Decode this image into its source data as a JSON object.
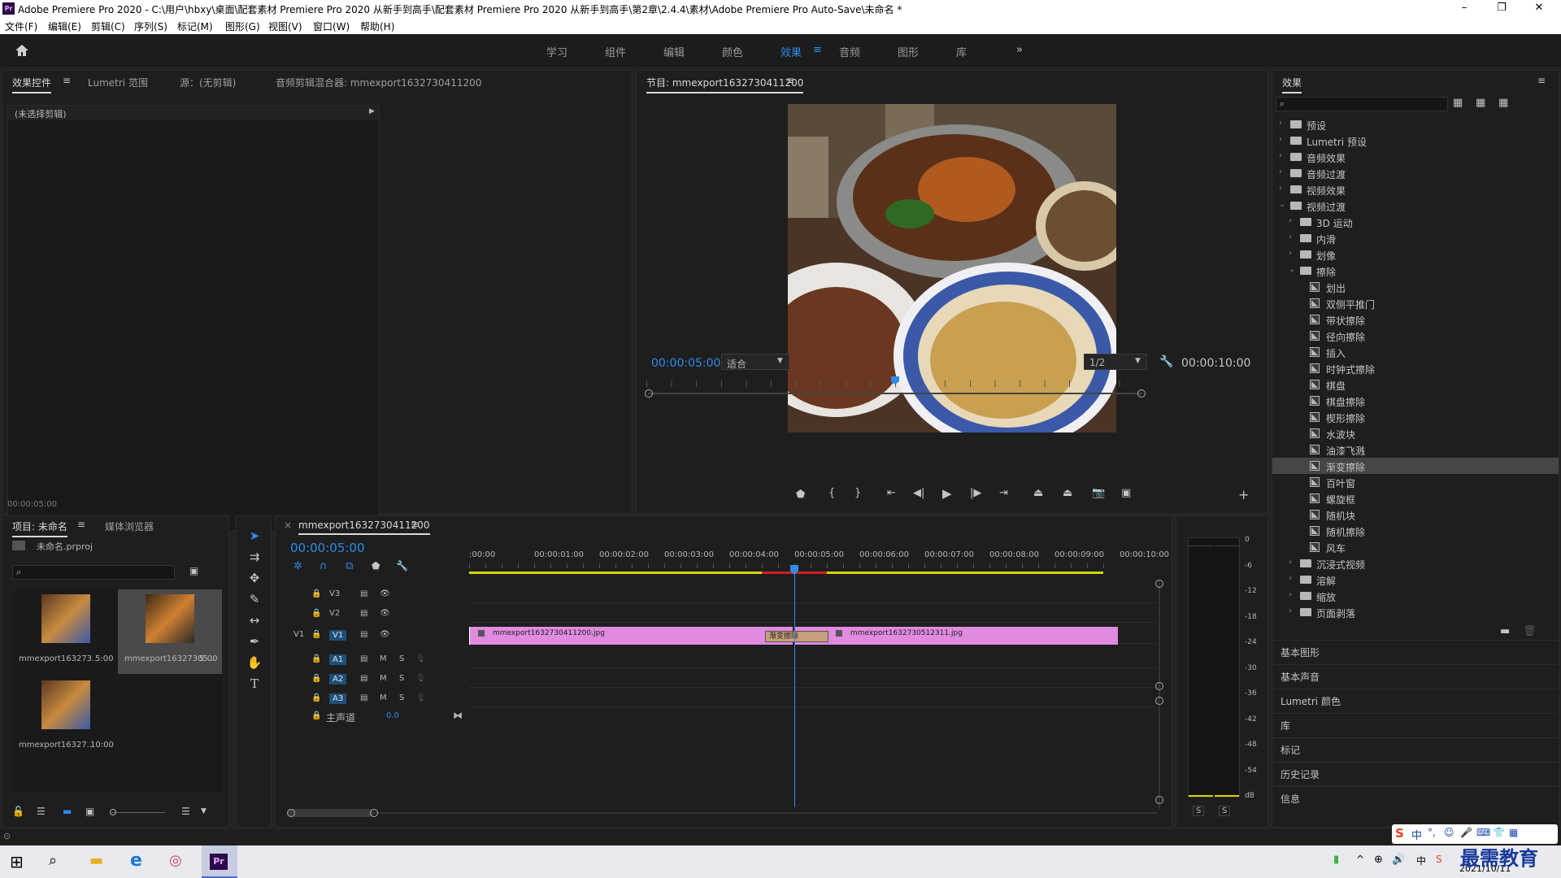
{
  "window": {
    "title": "Adobe Premiere Pro 2020 - C:\\用户\\hbxy\\桌面\\配套素材 Premiere Pro 2020 从新手到高手\\配套素材 Premiere Pro 2020 从新手到高手\\第2章\\2.4.4\\素材\\Adobe Premiere Pro Auto-Save\\未命名 *",
    "app_logo": "Pr",
    "minimize": "–",
    "maximize": "❐",
    "close": "✕"
  },
  "menu": [
    "文件(F)",
    "编辑(E)",
    "剪辑(C)",
    "序列(S)",
    "标记(M)",
    "图形(G)",
    "视图(V)",
    "窗口(W)",
    "帮助(H)"
  ],
  "workspaces": {
    "items": [
      "学习",
      "组件",
      "编辑",
      "颜色",
      "效果",
      "音频",
      "图形",
      "库"
    ],
    "active": "效果",
    "more": "»"
  },
  "effect_controls": {
    "tabs": [
      "效果控件",
      "Lumetri 范围",
      "源：(无剪辑)",
      "音频剪辑混合器: mmexport1632730411200"
    ],
    "no_clip": "(未选择剪辑)",
    "timecode": "00:00:05:00"
  },
  "program_monitor": {
    "title": "节目: mmexport1632730411200",
    "timecode_current": "00:00:05:00",
    "fit": "适合",
    "resolution": "1/2",
    "timecode_duration": "00:00:10:00",
    "playhead_fraction": 0.5
  },
  "effects_panel": {
    "title": "效果",
    "search_placeholder": "",
    "tree": [
      {
        "label": "预设",
        "level": 0,
        "type": "folder",
        "expanded": false
      },
      {
        "label": "Lumetri 预设",
        "level": 0,
        "type": "folder",
        "expanded": false
      },
      {
        "label": "音频效果",
        "level": 0,
        "type": "folder",
        "expanded": false
      },
      {
        "label": "音频过渡",
        "level": 0,
        "type": "folder",
        "expanded": false
      },
      {
        "label": "视频效果",
        "level": 0,
        "type": "folder",
        "expanded": false
      },
      {
        "label": "视频过渡",
        "level": 0,
        "type": "folder",
        "expanded": true
      },
      {
        "label": "3D 运动",
        "level": 1,
        "type": "folder",
        "expanded": false
      },
      {
        "label": "内滑",
        "level": 1,
        "type": "folder",
        "expanded": false
      },
      {
        "label": "划像",
        "level": 1,
        "type": "folder",
        "expanded": false
      },
      {
        "label": "擦除",
        "level": 1,
        "type": "folder",
        "expanded": true
      },
      {
        "label": "划出",
        "level": 2,
        "type": "effect"
      },
      {
        "label": "双侧平推门",
        "level": 2,
        "type": "effect"
      },
      {
        "label": "带状擦除",
        "level": 2,
        "type": "effect"
      },
      {
        "label": "径向擦除",
        "level": 2,
        "type": "effect"
      },
      {
        "label": "插入",
        "level": 2,
        "type": "effect"
      },
      {
        "label": "时钟式擦除",
        "level": 2,
        "type": "effect"
      },
      {
        "label": "棋盘",
        "level": 2,
        "type": "effect"
      },
      {
        "label": "棋盘擦除",
        "level": 2,
        "type": "effect"
      },
      {
        "label": "楔形擦除",
        "level": 2,
        "type": "effect"
      },
      {
        "label": "水波块",
        "level": 2,
        "type": "effect"
      },
      {
        "label": "油漆飞溅",
        "level": 2,
        "type": "effect"
      },
      {
        "label": "渐变擦除",
        "level": 2,
        "type": "effect",
        "selected": true
      },
      {
        "label": "百叶窗",
        "level": 2,
        "type": "effect"
      },
      {
        "label": "螺旋框",
        "level": 2,
        "type": "effect"
      },
      {
        "label": "随机块",
        "level": 2,
        "type": "effect"
      },
      {
        "label": "随机擦除",
        "level": 2,
        "type": "effect"
      },
      {
        "label": "风车",
        "level": 2,
        "type": "effect"
      },
      {
        "label": "沉浸式视频",
        "level": 1,
        "type": "folder",
        "expanded": false
      },
      {
        "label": "溶解",
        "level": 1,
        "type": "folder",
        "expanded": false
      },
      {
        "label": "缩放",
        "level": 1,
        "type": "folder",
        "expanded": false
      },
      {
        "label": "页面剥落",
        "level": 1,
        "type": "folder",
        "expanded": false
      }
    ],
    "collapsed_panels": [
      "基本图形",
      "基本声音",
      "Lumetri 颜色",
      "库",
      "标记",
      "历史记录",
      "信息"
    ]
  },
  "project": {
    "tabs": [
      "项目: 未命名",
      "媒体浏览器"
    ],
    "file": "未命名.prproj",
    "items": [
      {
        "name": "mmexport163273...",
        "duration": "5:00",
        "selected": false
      },
      {
        "name": "mmexport16327305...",
        "duration": "5:00",
        "selected": true
      },
      {
        "name": "mmexport16327...",
        "duration": "10:00",
        "selected": false
      }
    ]
  },
  "timeline": {
    "tab": "mmexport1632730411200",
    "timecode": "00:00:05:00",
    "ruler": [
      ":00:00",
      "00:00:01:00",
      "00:00:02:00",
      "00:00:03:00",
      "00:00:04:00",
      "00:00:05:00",
      "00:00:06:00",
      "00:00:07:00",
      "00:00:08:00",
      "00:00:09:00",
      "00:00:10:00"
    ],
    "tracks": [
      {
        "id": "V3",
        "src": ""
      },
      {
        "id": "V2",
        "src": ""
      },
      {
        "id": "V1",
        "src": "V1"
      },
      {
        "id": "A1",
        "src": "",
        "m": "M",
        "s": "S"
      },
      {
        "id": "A2",
        "src": "",
        "m": "M",
        "s": "S"
      },
      {
        "id": "A3",
        "src": "",
        "m": "M",
        "s": "S"
      }
    ],
    "master": {
      "label": "主声道",
      "value": "0.0"
    },
    "clips": [
      {
        "name": "mmexport1632730411200.jpg",
        "start": 0,
        "end": 5
      },
      {
        "name": "mmexport1632730512311.jpg",
        "start": 5,
        "end": 10
      }
    ],
    "transition": "渐变擦除",
    "playhead_seconds": 5,
    "duration_seconds": 10
  },
  "audio_meter": {
    "scale": [
      "0",
      "-6",
      "-12",
      "-18",
      "-24",
      "-30",
      "-36",
      "-42",
      "-48",
      "-54",
      "dB"
    ],
    "solo": [
      "S",
      "S"
    ]
  },
  "taskbar": {
    "date": "2021/10/11",
    "ime": "中",
    "watermark": "最需教育"
  },
  "colors": {
    "accent": "#2d8ceb",
    "clip": "#e08ae0",
    "selected_row": "#464646"
  }
}
